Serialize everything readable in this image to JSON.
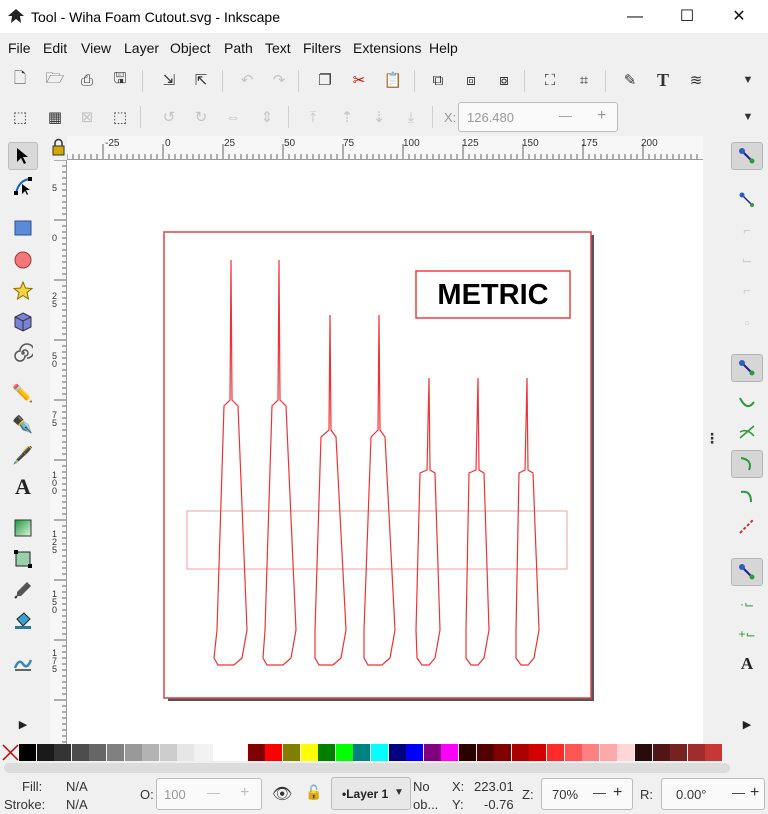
{
  "window": {
    "title": "Tool - Wiha Foam Cutout.svg - Inkscape",
    "minimize_glyph": "—",
    "maximize_glyph": "☐",
    "close_glyph": "✕"
  },
  "menu": [
    "File",
    "Edit",
    "View",
    "Layer",
    "Object",
    "Path",
    "Text",
    "Filters",
    "Extensions",
    "Help"
  ],
  "toolbar": {
    "more_glyph": "▼"
  },
  "tool_controls": {
    "x_label": "X:",
    "x_value": "126.480",
    "minus": "—",
    "plus": "+",
    "more_glyph": "▼"
  },
  "ruler": {
    "labels": [
      "-25",
      "0",
      "25",
      "50",
      "75",
      "100",
      "125",
      "150",
      "175",
      "200"
    ]
  },
  "canvas": {
    "label_text": "METRIC",
    "colors": {
      "cut_lines": "#ee3333",
      "page_border": "#dd4444",
      "page_shadow": "#555555",
      "guide_rect": "#f0a0a0"
    }
  },
  "vruler": {
    "labels": [
      "5",
      "0",
      "2 5",
      "5 0",
      "7 5",
      "1 0 0",
      "1 2 5",
      "1 5 0",
      "1 7 5"
    ]
  },
  "status": {
    "fill_label": "Fill:",
    "fill_value": "N/A",
    "stroke_label": "Stroke:",
    "stroke_value": "N/A",
    "opacity_label": "O:",
    "opacity_value": "100",
    "layer_label": "•Layer 1",
    "no_objects_line1": "No",
    "no_objects_line2": "ob...",
    "x_label": "X:",
    "x_value": "223.01",
    "y_label": "Y:",
    "y_value": "-0.76",
    "zoom_label": "Z:",
    "zoom_value": "70%",
    "rotate_label": "R:",
    "rotate_value": "0.00°",
    "minus": "—",
    "plus": "+"
  },
  "palette_colors": [
    "#000000",
    "#1a1a1a",
    "#333333",
    "#4d4d4d",
    "#666666",
    "#808080",
    "#999999",
    "#b3b3b3",
    "#cccccc",
    "#e6e6e6",
    "#f2f2f2",
    "#ffffff",
    "#ffffff",
    "#800000",
    "#ff0000",
    "#808000",
    "#ffff00",
    "#008000",
    "#00ff00",
    "#008080",
    "#00ffff",
    "#000080",
    "#0000ff",
    "#800080",
    "#ff00ff",
    "#2b0000",
    "#550000",
    "#800000",
    "#aa0000",
    "#d40000",
    "#ff2a2a",
    "#ff5555",
    "#ff8080",
    "#ffaaaa",
    "#ffd5d5",
    "#280b0b",
    "#501616",
    "#782121",
    "#a02c2c",
    "#c83737"
  ]
}
